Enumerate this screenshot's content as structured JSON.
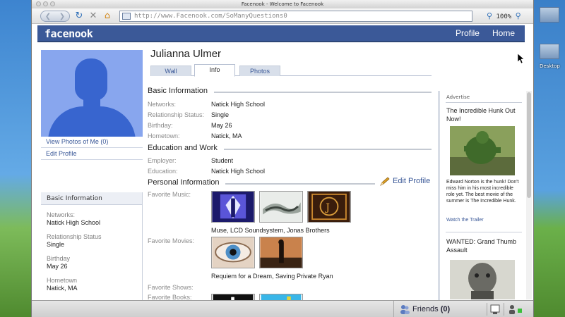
{
  "window": {
    "title": "Facenook - Welcome to Facenook"
  },
  "browser": {
    "url": "http://www.Facenook.com/SoManyQuestions0",
    "zoom": "100%"
  },
  "desktop": {
    "icon_label": "Desktop"
  },
  "header": {
    "logo": "facenook",
    "nav": {
      "profile": "Profile",
      "home": "Home"
    }
  },
  "profile": {
    "name": "Julianna Ulmer",
    "tabs": [
      "Wall",
      "Info",
      "Photos"
    ],
    "active_tab": "Info"
  },
  "left_links": {
    "view_photos": "View Photos of Me (0)",
    "edit_profile": "Edit Profile"
  },
  "left_box": {
    "title": "Basic Information",
    "items": [
      {
        "label": "Networks:",
        "value": "Natick High School"
      },
      {
        "label": "Relationship Status",
        "value": "Single"
      },
      {
        "label": "Birthday",
        "value": "May 26"
      },
      {
        "label": "Hometown",
        "value": "Natick, MA"
      }
    ]
  },
  "basic_info": {
    "title": "Basic Information",
    "rows": [
      {
        "label": "Networks:",
        "value": "Natick High School"
      },
      {
        "label": "Relationship Status:",
        "value": "Single"
      },
      {
        "label": "Birthday:",
        "value": "May 26"
      },
      {
        "label": "Hometown:",
        "value": "Natick, MA"
      }
    ]
  },
  "education": {
    "title": "Education and Work",
    "rows": [
      {
        "label": "Employer:",
        "value": "Student"
      },
      {
        "label": "Education:",
        "value": "Natick High School"
      }
    ]
  },
  "personal": {
    "title": "Personal Information",
    "edit_label": "Edit Profile",
    "music_label": "Favorite Music:",
    "music_caption": "Muse, LCD Soundsystem, Jonas Brothers",
    "movies_label": "Favorite Movies:",
    "movies_caption": "Requiem for a Dream, Saving Private Ryan",
    "shows_label": "Favorite Shows:",
    "books_label": "Favorite Books:"
  },
  "ads": {
    "header": "Advertise",
    "ad1": {
      "title": "The Incredible Hunk Out Now!",
      "text": "Edward Norton is the hunk! Don't miss him in his most incredible role yet. The best movie of the summer is The Incredible Hunk.",
      "link": "Watch the Trailer"
    },
    "ad2": {
      "title": "WANTED: Grand Thumb Assault"
    }
  },
  "statusbar": {
    "friends_label": "Friends",
    "friends_count": "(0)"
  },
  "colors": {
    "brand": "#3b5998",
    "link": "#3b5998",
    "silhouette": "#3865cf"
  }
}
